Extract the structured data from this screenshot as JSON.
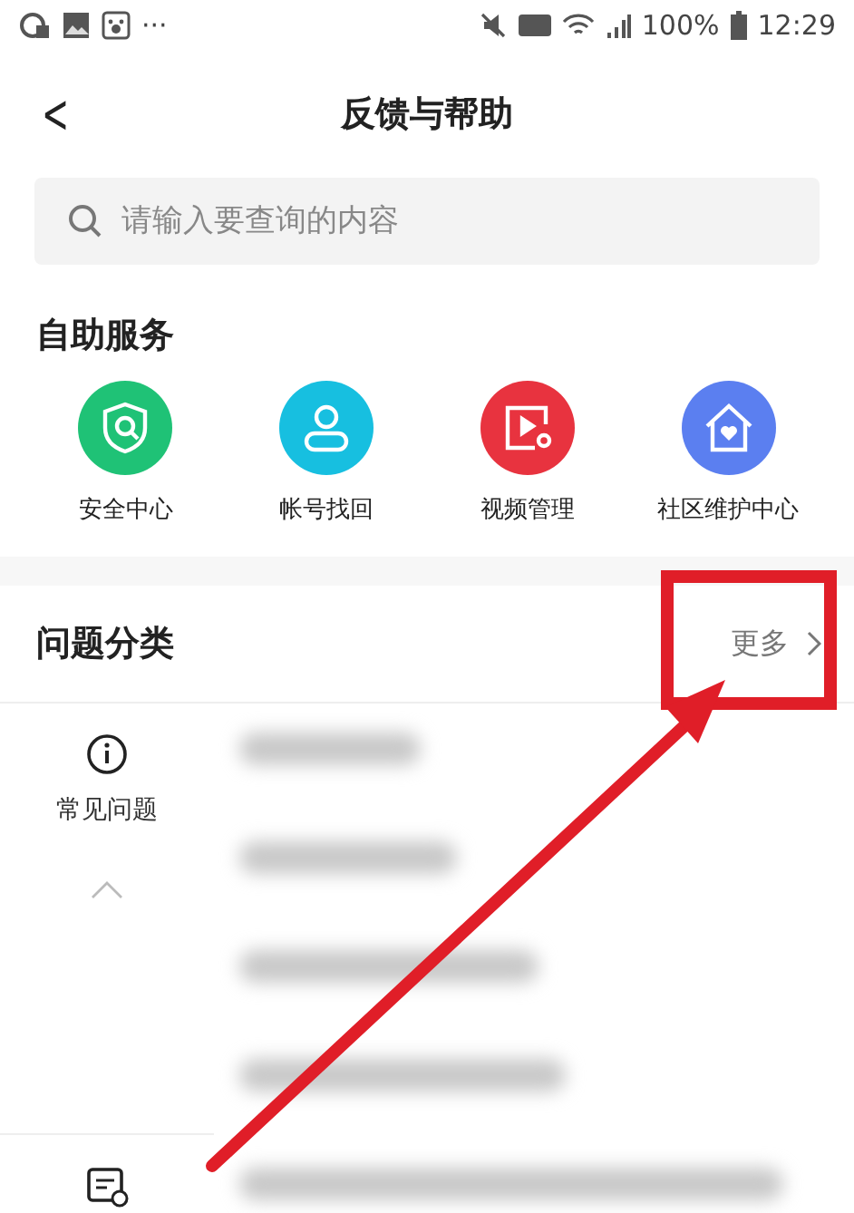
{
  "status_bar": {
    "dots": "···",
    "battery": "100%",
    "time": "12:29"
  },
  "header": {
    "back": "<",
    "title": "反馈与帮助"
  },
  "search": {
    "placeholder": "请输入要查询的内容"
  },
  "self_service": {
    "title": "自助服务",
    "items": [
      {
        "label": "安全中心",
        "kind": "shield",
        "color": "#1fc276"
      },
      {
        "label": "帐号找回",
        "kind": "person",
        "color": "#17bfe0"
      },
      {
        "label": "视频管理",
        "kind": "video",
        "color": "#e8333f"
      },
      {
        "label": "社区维护中心",
        "kind": "house",
        "color": "#5b7ff0"
      }
    ]
  },
  "categories": {
    "title": "问题分类",
    "more": "更多",
    "sidebar": [
      {
        "label": "常见问题",
        "kind": "info",
        "expanded": true
      },
      {
        "kind": "ticket"
      }
    ],
    "rows": [
      {
        "kind": "blurred"
      },
      {
        "kind": "blurred"
      },
      {
        "kind": "blurred"
      },
      {
        "kind": "blurred"
      },
      {
        "kind": "blurred"
      }
    ]
  }
}
